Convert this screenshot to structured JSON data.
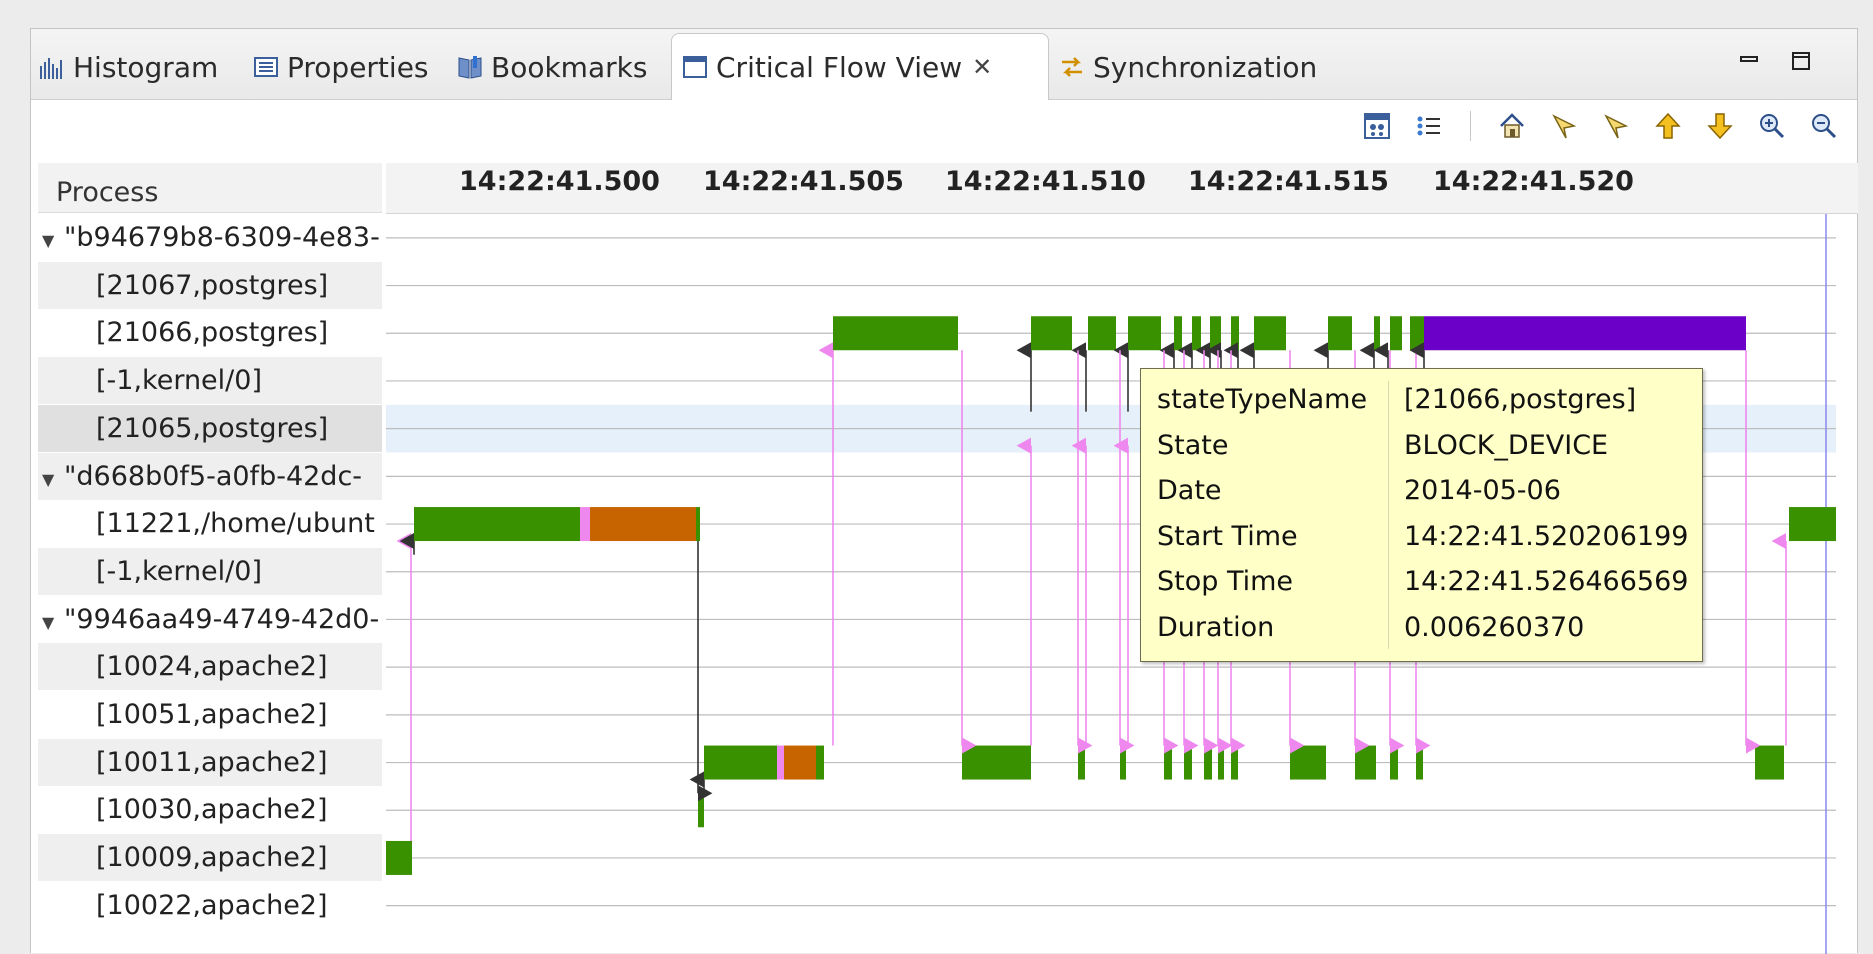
{
  "tabs": [
    {
      "label": "Histogram",
      "icon": "histogram-icon"
    },
    {
      "label": "Properties",
      "icon": "properties-icon"
    },
    {
      "label": "Bookmarks",
      "icon": "bookmarks-icon"
    },
    {
      "label": "Critical Flow View",
      "icon": "view-icon",
      "active": true
    },
    {
      "label": "Synchronization",
      "icon": "synchronization-icon"
    }
  ],
  "tree": {
    "header": "Process",
    "rows": [
      {
        "label": "\"b94679b8-6309-4e83-",
        "group": true
      },
      {
        "label": "[21067,postgres]"
      },
      {
        "label": "[21066,postgres]"
      },
      {
        "label": "[-1,kernel/0]"
      },
      {
        "label": "[21065,postgres]",
        "selected": true
      },
      {
        "label": "\"d668b0f5-a0fb-42dc-",
        "group": true
      },
      {
        "label": "[11221,/home/ubunt"
      },
      {
        "label": "[-1,kernel/0]"
      },
      {
        "label": "\"9946aa49-4749-42d0-",
        "group": true
      },
      {
        "label": "[10024,apache2]"
      },
      {
        "label": "[10051,apache2]"
      },
      {
        "label": "[10011,apache2]"
      },
      {
        "label": "[10030,apache2]"
      },
      {
        "label": "[10009,apache2]"
      },
      {
        "label": "[10022,apache2]"
      }
    ]
  },
  "time_axis": {
    "ticks": [
      "14:22:41.500",
      "14:22:41.505",
      "14:22:41.510",
      "14:22:41.515",
      "14:22:41.520"
    ]
  },
  "tooltip": {
    "rows": [
      {
        "key": "stateTypeName",
        "value": "[21066,postgres]"
      },
      {
        "key": "State",
        "value": "BLOCK_DEVICE"
      },
      {
        "key": "Date",
        "value": "2014-05-06"
      },
      {
        "key": "Start Time",
        "value": "14:22:41.520206199"
      },
      {
        "key": "Stop Time",
        "value": "14:22:41.526466569"
      },
      {
        "key": "Duration",
        "value": "0.006260370"
      }
    ]
  },
  "colors": {
    "running": "#3a9100",
    "preempted": "#c86400",
    "block_device": "#6b00c8",
    "link": "#ee88ee",
    "arrow": "#333333",
    "selection": "#e6f0fb"
  },
  "toolbar": [
    "legend-icon",
    "details-icon",
    "home-icon",
    "previous-event-icon",
    "next-event-icon",
    "previous-item-icon",
    "next-item-icon",
    "zoom-in-icon",
    "zoom-out-icon"
  ]
}
